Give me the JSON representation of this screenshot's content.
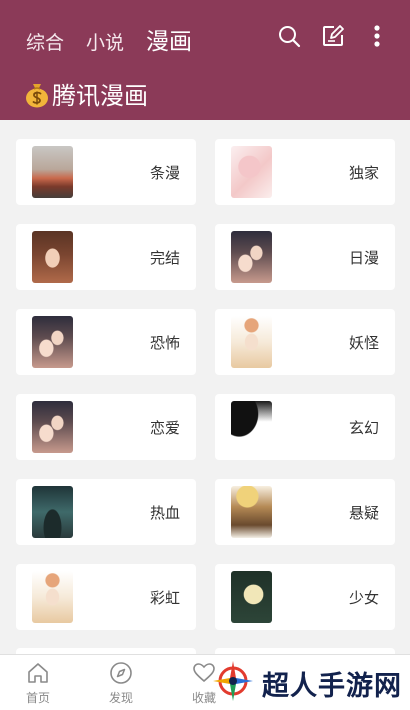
{
  "header": {
    "tabs": [
      {
        "label": "综合",
        "active": false
      },
      {
        "label": "小说",
        "active": false
      },
      {
        "label": "漫画",
        "active": true
      }
    ],
    "icons": [
      "search-icon",
      "edit-icon",
      "more-icon"
    ],
    "section_title": "腾讯漫画",
    "section_icon": "money-bag-icon",
    "color": "#8b3a58"
  },
  "categories": [
    {
      "label": "条漫"
    },
    {
      "label": "独家"
    },
    {
      "label": "完结"
    },
    {
      "label": "日漫"
    },
    {
      "label": "恐怖"
    },
    {
      "label": "妖怪"
    },
    {
      "label": "恋爱"
    },
    {
      "label": "玄幻"
    },
    {
      "label": "热血"
    },
    {
      "label": "悬疑"
    },
    {
      "label": "彩虹"
    },
    {
      "label": "少女"
    }
  ],
  "bottom_nav": [
    {
      "label": "首页",
      "icon": "home-icon"
    },
    {
      "label": "发现",
      "icon": "compass-icon"
    },
    {
      "label": "收藏",
      "icon": "heart-icon"
    }
  ],
  "watermark": "超人手游网"
}
